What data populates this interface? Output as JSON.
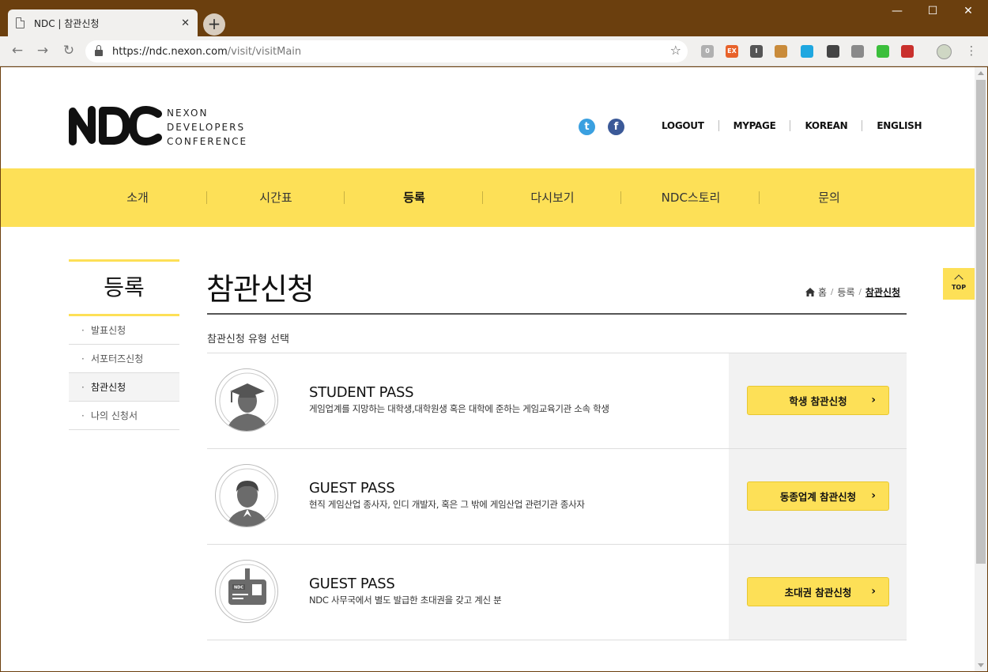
{
  "browser": {
    "tab_title": "NDC | 참관신청",
    "tab_close": "✕",
    "new_tab": "+",
    "url_host": "https://ndc.nexon.com",
    "url_path": "/visit/visitMain",
    "star": "☆",
    "back": "←",
    "forward": "→",
    "reload": "↻",
    "minimize": "—",
    "maximize": "☐",
    "close": "✕",
    "menu": "⋮",
    "extensions": [
      {
        "name": "ext-0",
        "color": "#b0b0b0",
        "label": "0"
      },
      {
        "name": "ext-ex",
        "color": "#e8622a",
        "label": "EX"
      },
      {
        "name": "ext-i",
        "color": "#555555",
        "label": "I"
      },
      {
        "name": "ext-flask",
        "color": "#c98b3a",
        "label": ""
      },
      {
        "name": "ext-eye",
        "color": "#1fa7e0",
        "label": ""
      },
      {
        "name": "ext-dropper",
        "color": "#444444",
        "label": ""
      },
      {
        "name": "ext-msg",
        "color": "#8a8a8a",
        "label": ""
      },
      {
        "name": "ext-up",
        "color": "#3cbf3c",
        "label": ""
      },
      {
        "name": "ext-pdf",
        "color": "#c9302c",
        "label": ""
      }
    ]
  },
  "header": {
    "logo_lines": [
      "NEXON",
      "DEVELOPERS",
      "CONFERENCE"
    ],
    "twitter_glyph": "t",
    "facebook_glyph": "f",
    "util_links": [
      "LOGOUT",
      "MYPAGE",
      "KOREAN",
      "ENGLISH"
    ]
  },
  "gnb": {
    "items": [
      "소개",
      "시간표",
      "등록",
      "다시보기",
      "NDC스토리",
      "문의"
    ],
    "active_index": 2
  },
  "lnb": {
    "title": "등록",
    "items": [
      "발표신청",
      "서포터즈신청",
      "참관신청",
      "나의 신청서"
    ],
    "active_index": 2
  },
  "content": {
    "title": "참관신청",
    "breadcrumb": [
      "홈",
      "등록",
      "참관신청"
    ],
    "section_label": "참관신청 유형 선택",
    "passes": [
      {
        "icon": "graduate-icon",
        "name": "STUDENT PASS",
        "desc": "게임업계를 지망하는 대학생,대학원생 혹은 대학에 준하는 게임교육기관 소속 학생",
        "button": "학생 참관신청"
      },
      {
        "icon": "person-icon",
        "name": "GUEST PASS",
        "desc": "현직 게임산업 종사자, 인디 개발자, 혹은 그 밖에 게임산업 관련기관 종사자",
        "button": "동종업계 참관신청"
      },
      {
        "icon": "badge-icon",
        "name": "GUEST PASS",
        "desc": "NDC 사무국에서 별도 발급한 초대권을 갖고 계신 분",
        "button": "초대권 참관신청"
      }
    ],
    "chevron": "›",
    "top_label": "TOP",
    "badge_text": "NDC"
  },
  "colors": {
    "accent": "#fde057",
    "chrome": "#6b3f0e",
    "twitter": "#3aa0e0",
    "facebook": "#3b5998"
  }
}
